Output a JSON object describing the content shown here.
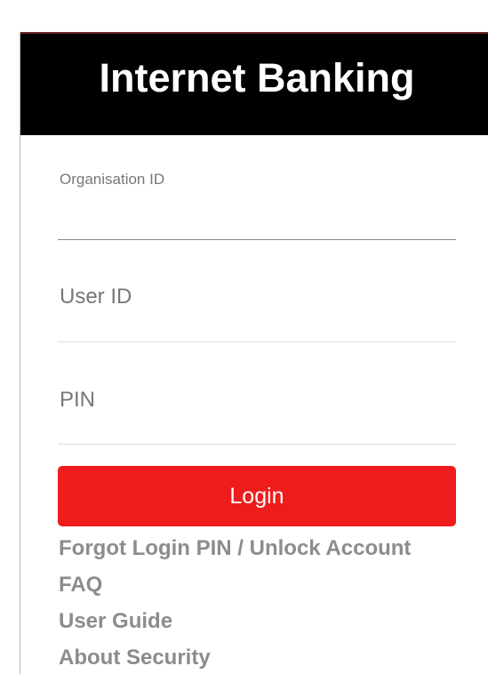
{
  "header": {
    "title": "Internet Banking"
  },
  "form": {
    "organisation_id": {
      "label": "Organisation ID",
      "value": ""
    },
    "user_id": {
      "placeholder": "User ID",
      "value": ""
    },
    "pin": {
      "placeholder": "PIN",
      "value": ""
    },
    "login_label": "Login"
  },
  "links": [
    "Forgot Login PIN / Unlock Account",
    "FAQ",
    "User Guide",
    "About Security"
  ],
  "colors": {
    "header_bg": "#000000",
    "accent": "#ee1c1c",
    "link": "#8c8c8c",
    "label": "#777777"
  }
}
